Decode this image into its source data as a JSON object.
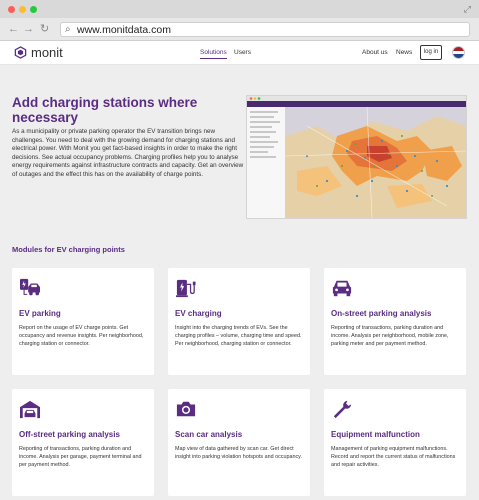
{
  "browser": {
    "url": "www.monitdata.com",
    "back_icon": "arrow-left",
    "forward_icon": "arrow-right",
    "reload_icon": "reload",
    "search_icon": "magnifier",
    "expand_icon": "expand-arrows"
  },
  "header": {
    "logo_text": "monit",
    "nav": {
      "solutions": "Solutions",
      "users": "Users",
      "about": "About us",
      "news": "News"
    },
    "login": "log in",
    "language_flag": "netherlands-flag"
  },
  "hero": {
    "title": "Add charging stations where necessary",
    "body": "As a municipality or private parking operator the EV transition brings new challenges. You need to deal with the growing demand for charging stations and electrical power. With Monit you get fact-based insights in order to make the right decisions. See actual occupancy problems. Charging profiles help you to analyse energy requirements against infrastructure contracts and capacity. Get an overview of outages and the effect this has on the availability of charge points."
  },
  "modules": {
    "heading": "Modules for EV charging points",
    "cards": [
      {
        "icon": "ev-car-icon",
        "title": "EV parking",
        "desc": "Report on the usage of EV charge points. Get occupancy and revenue insights. Per neighborhood, charging station or connector."
      },
      {
        "icon": "charging-station-icon",
        "title": "EV charging",
        "desc": "Insight into the charging trends of EVs. See the charging profiles – volume, charging time and speed. Per neighborhood, charging station or connector."
      },
      {
        "icon": "car-icon",
        "title": "On-street parking analysis",
        "desc": "Reporting of transactions, parking duration and income. Analysis per neighborhood, mobile zone, parking meter and per payment method."
      },
      {
        "icon": "garage-icon",
        "title": "Off-street parking analysis",
        "desc": "Reporting of transactions, parking duration and income. Analysis per garage, payment terminal and per payment method."
      },
      {
        "icon": "camera-icon",
        "title": "Scan car analysis",
        "desc": "Map view of data gathered by scan car. Get direct insight into parking violation hotspots and occupancy."
      },
      {
        "icon": "wrench-icon",
        "title": "Equipment malfunction",
        "desc": "Management of parking equipment malfunctions. Record and report the current status of malfunctions and repair activities."
      }
    ]
  },
  "colors": {
    "brand_purple": "#5a2d82",
    "page_gray": "#eeeeee",
    "heatmap_orange": "#f0a04b"
  }
}
